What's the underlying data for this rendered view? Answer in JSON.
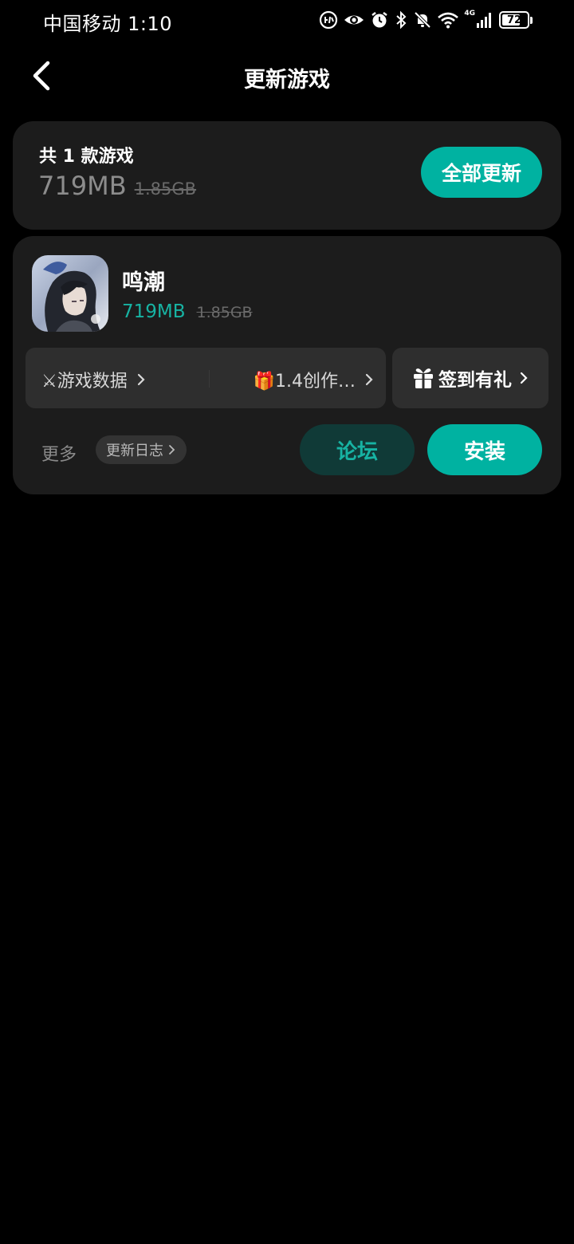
{
  "status_bar": {
    "carrier": "中国移动",
    "time": "1:10",
    "network": "4G",
    "battery": "72",
    "battery_level": 0.72,
    "icons": [
      "hd-call-icon",
      "eye-comfort-icon",
      "alarm-icon",
      "bluetooth-icon",
      "mute-icon",
      "wifi-icon",
      "signal-icon",
      "battery-icon"
    ]
  },
  "header": {
    "title": "更新游戏",
    "back_icon": "chevron-left-icon"
  },
  "summary": {
    "count_text": "共 1 款游戏",
    "new_size": "719MB",
    "old_size": "1.85GB",
    "update_all_label": "全部更新"
  },
  "game": {
    "name": "鸣潮",
    "new_size": "719MB",
    "old_size": "1.85GB",
    "data_link": "⚔游戏数据",
    "event_link": "🎁1.4创作…",
    "gift_label": "签到有礼",
    "more_label": "更多",
    "changelog_label": "更新日志",
    "forum_label": "论坛",
    "install_label": "安装"
  },
  "colors": {
    "accent": "#00b2a1",
    "accent_dark": "#103a37",
    "card": "#1c1c1c",
    "background": "#000000"
  }
}
